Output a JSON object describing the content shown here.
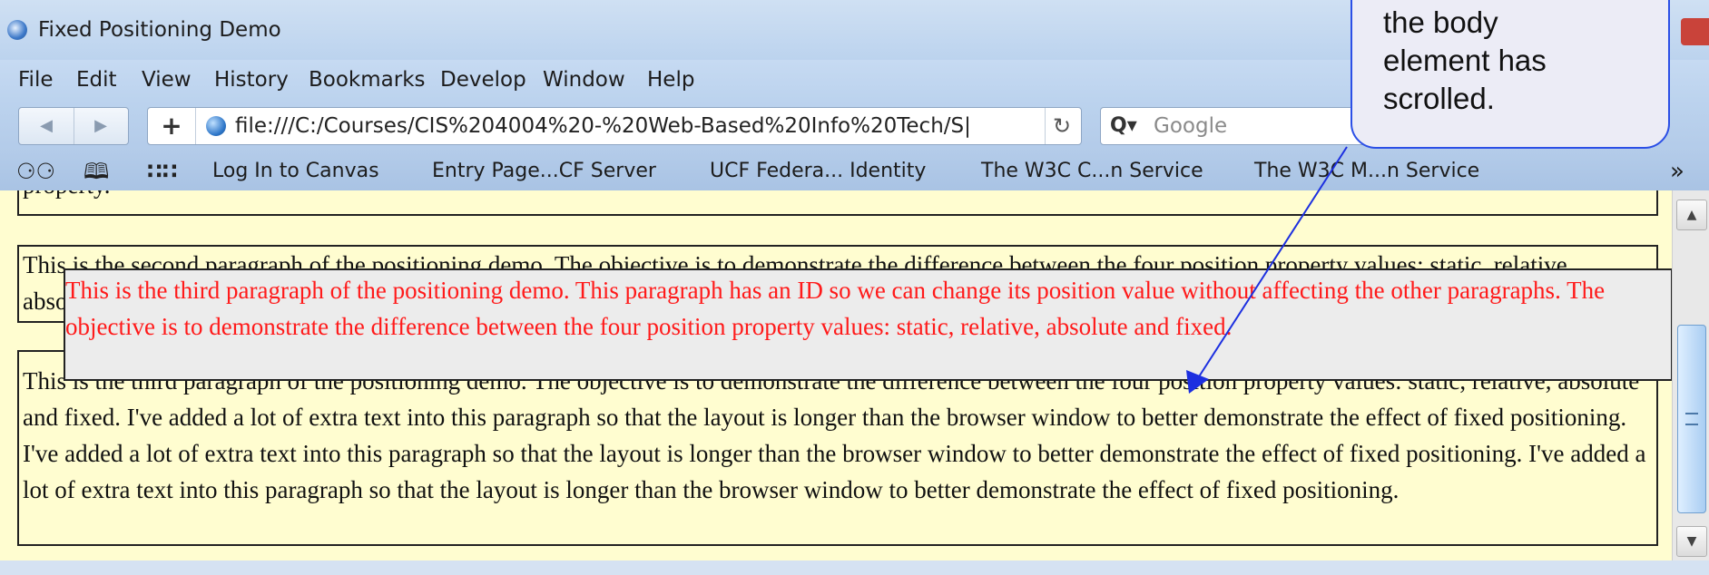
{
  "window": {
    "title": "Fixed Positioning Demo"
  },
  "menu": [
    "File",
    "Edit",
    "View",
    "History",
    "Bookmarks",
    "Develop",
    "Window",
    "Help"
  ],
  "menu_underline_letters": [
    "F",
    "E",
    "V",
    "s",
    "B",
    "",
    "W",
    "H"
  ],
  "toolbar": {
    "url": "file:///C:/Courses/CIS%204004%20-%20Web-Based%20Info%20Tech/S|",
    "search_placeholder": "Google",
    "back_glyph": "◀",
    "forward_glyph": "▶",
    "new_tab_glyph": "+",
    "reload_glyph": "↻"
  },
  "bookmarks": [
    "Log In to Canvas",
    "Entry Page...CF Server",
    "UCF Federa... Identity",
    "The W3C C...n Service",
    "The W3C M...n Service"
  ],
  "bookmarks_overflow": "»",
  "content": {
    "p1_tail": "property.",
    "p2": "This is the second paragraph of the positioning demo. The objective is to demonstrate the difference between the four position property values: static, relative, absolute and fixed.",
    "p3": "This is the third paragraph of the positioning demo. The objective is to demonstrate the difference between the four position property values: static, relative, absolute and fixed. I've added a lot of extra text into this paragraph so that the layout is longer than the browser window to better demonstrate the effect of fixed positioning. I've added a lot of extra text into this paragraph so that the layout is longer than the browser window to better demonstrate the effect of fixed positioning. I've added a lot of extra text into this paragraph so that the layout is longer than the browser window to better demonstrate the effect of fixed positioning.",
    "fixed_paragraph": "This is the third paragraph of the positioning demo. This paragraph has an ID so we can change its position value without affecting the other paragraphs. The objective is to demonstrate the difference between the four position property values: static, relative, absolute and fixed."
  },
  "callout": {
    "lines": [
      "the body",
      "element has",
      "scrolled."
    ]
  },
  "colors": {
    "page_background": "#fffdd0",
    "fixed_text": "#ff1a1a",
    "callout_border": "#2b4fe6"
  }
}
